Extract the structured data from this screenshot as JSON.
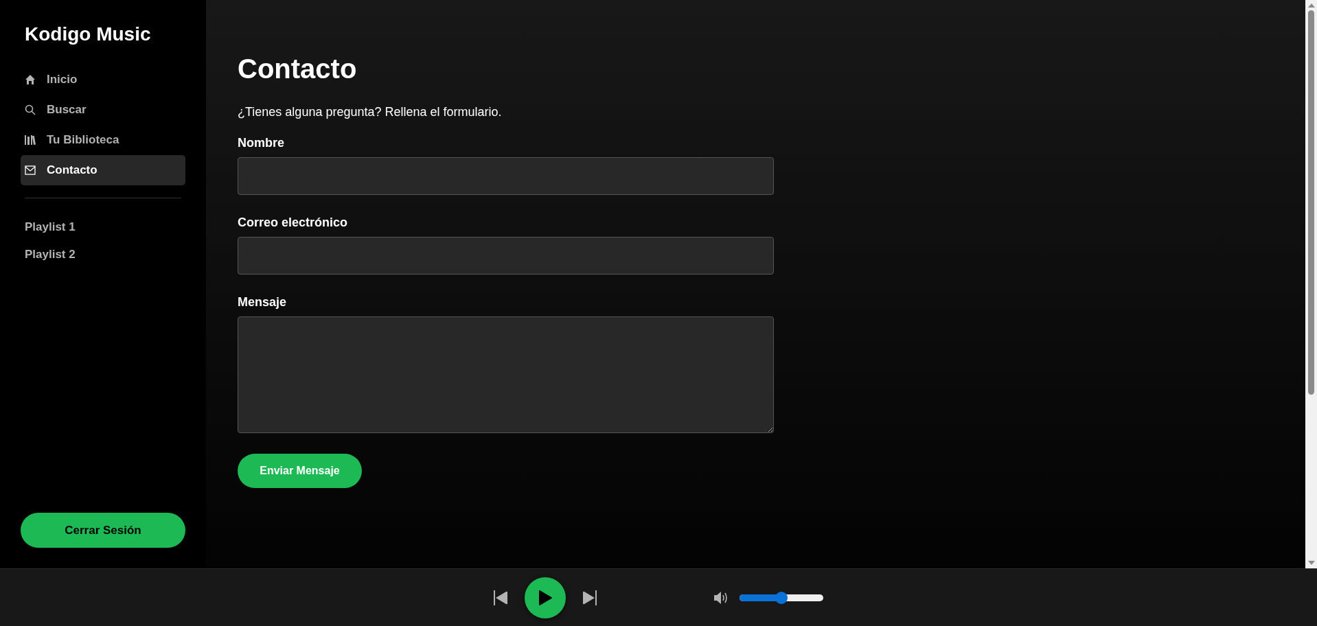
{
  "sidebar": {
    "logo": "Kodigo Music",
    "nav": [
      {
        "label": "Inicio",
        "selected": false
      },
      {
        "label": "Buscar",
        "selected": false
      },
      {
        "label": "Tu Biblioteca",
        "selected": false
      },
      {
        "label": "Contacto",
        "selected": true
      }
    ],
    "playlists": [
      "Playlist 1",
      "Playlist 2"
    ],
    "logout": "Cerrar Sesión"
  },
  "main": {
    "title": "Contacto",
    "intro": "¿Tienes alguna pregunta? Rellena el formulario.",
    "fields": [
      {
        "label": "Nombre",
        "kind": "input"
      },
      {
        "label": "Correo electrónico",
        "kind": "input"
      },
      {
        "label": "Mensaje",
        "kind": "textarea"
      }
    ],
    "submit": "Enviar Mensaje"
  },
  "player": {
    "volume": {
      "level": 0.5
    }
  }
}
